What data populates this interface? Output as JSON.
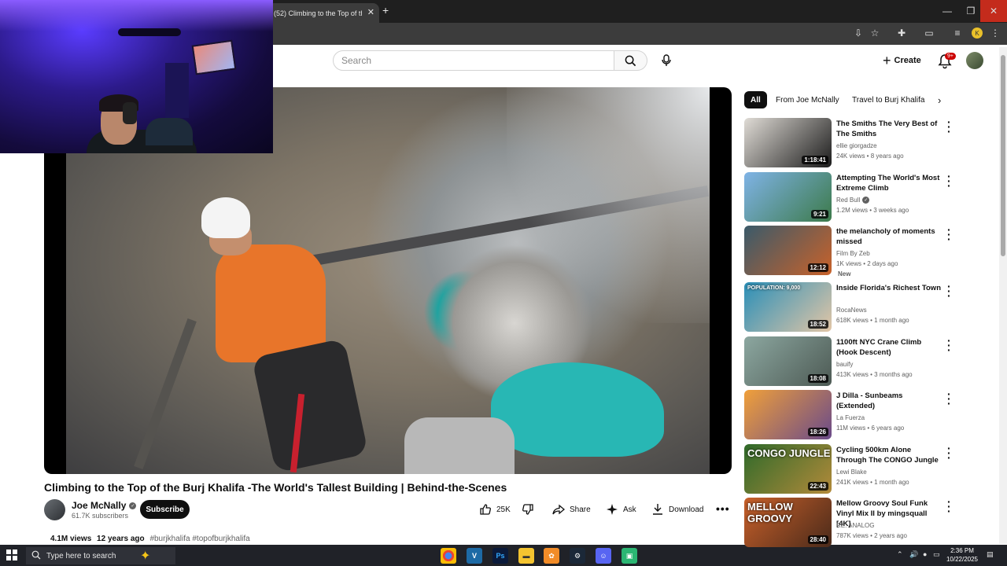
{
  "browser": {
    "tab_title": "(52) Climbing to the Top of the",
    "profile_initial": "K",
    "icons": [
      "tab-close-icon",
      "new-tab-icon",
      "minimize-icon",
      "maximize-icon",
      "window-close-icon",
      "install-icon",
      "star-icon",
      "extensions-icon",
      "cast-icon",
      "media-icon",
      "menu-icon"
    ]
  },
  "header": {
    "search_placeholder": "Search",
    "create_label": "Create",
    "notification_count": "9+"
  },
  "video": {
    "title": "Climbing to the Top of the Burj Khalifa -The World's Tallest Building | Behind-the-Scenes",
    "channel": "Joe McNally",
    "subscribers": "61.7K subscribers",
    "subscribe_label": "Subscribe",
    "likes": "25K",
    "share_label": "Share",
    "ask_label": "Ask",
    "download_label": "Download",
    "more_label": "•••",
    "views": "4.1M views",
    "age": "12 years ago",
    "tags": "#burjkhalifa #topofburjkhalifa"
  },
  "chips": {
    "all": "All",
    "from_channel": "From Joe McNally",
    "travel": "Travel to Burj Khalifa"
  },
  "recommendations": [
    {
      "title": "The Smiths   The Very Best of The Smiths",
      "channel": "ellie giorgadze",
      "meta": "24K views • 8 years ago",
      "duration": "1:18:41",
      "verified": false,
      "badge": "",
      "thumb_colors": [
        "#e0dcd6",
        "#1b1b1b"
      ]
    },
    {
      "title": "Attempting The World's Most Extreme Climb",
      "channel": "Red Bull",
      "meta": "1.2M views • 3 weeks ago",
      "duration": "9:21",
      "verified": true,
      "badge": "",
      "thumb_colors": [
        "#7fb3e6",
        "#3c7a4a"
      ]
    },
    {
      "title": "the melancholy of moments missed",
      "channel": "Film By Zeb",
      "meta": "1K views • 2 days ago",
      "duration": "12:12",
      "verified": false,
      "badge": "New",
      "thumb_colors": [
        "#3a5a6a",
        "#c9622a"
      ]
    },
    {
      "title": "Inside Florida's Richest Town",
      "channel": "RocaNews",
      "meta": "618K views • 1 month ago",
      "duration": "18:52",
      "verified": false,
      "badge": "",
      "thumb_colors": [
        "#2a8fb8",
        "#e3c6a6"
      ]
    },
    {
      "title": "1100ft NYC Crane Climb (Hook Descent)",
      "channel": "bauify",
      "meta": "413K views • 3 months ago",
      "duration": "18:08",
      "verified": false,
      "badge": "",
      "thumb_colors": [
        "#8ca7a0",
        "#4d5a54"
      ]
    },
    {
      "title": "J Dilla - Sunbeams (Extended)",
      "channel": "La Fuerza",
      "meta": "11M views • 6 years ago",
      "duration": "18:26",
      "verified": false,
      "badge": "",
      "thumb_colors": [
        "#f0a03a",
        "#6a4a8a"
      ]
    },
    {
      "title": "Cycling 500km Alone Through The CONGO Jungle",
      "channel": "Lewi Blake",
      "meta": "241K views • 1 month ago",
      "duration": "22:43",
      "verified": false,
      "badge": "",
      "thumb_colors": [
        "#2f6a2a",
        "#b28a3a"
      ]
    },
    {
      "title": "Mellow Groovy Soul Funk Vinyl Mix II by mingsquall [4K]",
      "channel": "RE: ANALOG",
      "meta": "787K views • 2 years ago",
      "duration": "28:40",
      "verified": false,
      "badge": "",
      "thumb_colors": [
        "#c8602a",
        "#4a2a1a"
      ]
    }
  ],
  "thumb_text": {
    "rec_3": "POPULATION: 9,000",
    "rec_6": "CONGO JUNGLE",
    "rec_7": "MELLOW GROOVY"
  },
  "taskbar": {
    "search_placeholder": "Type here to search",
    "time": "2:36 PM",
    "date": "10/22/2025",
    "apps": [
      "chrome-icon",
      "vegas-icon",
      "photoshop-icon",
      "file-explorer-icon",
      "fl-studio-icon",
      "steam-icon",
      "discord-icon",
      "app-icon"
    ]
  }
}
